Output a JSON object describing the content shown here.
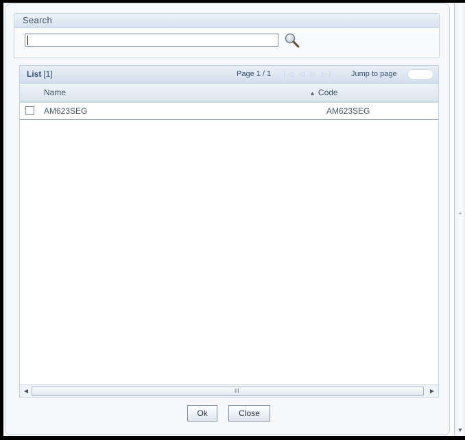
{
  "search": {
    "title": "Search",
    "input_value": "",
    "button_icon": "magnifier-icon"
  },
  "list": {
    "title": "List",
    "count": "[1]",
    "page_info": "Page 1 / 1",
    "jump_label": "Jump to page",
    "columns": {
      "name": "Name",
      "code": "Code"
    },
    "sort_indicator": "▲",
    "rows": [
      {
        "name": "AM623SEG",
        "code": "AM623SEG",
        "checked": false
      }
    ],
    "hscroll_grip": "III"
  },
  "buttons": {
    "ok": "Ok",
    "close": "Close"
  },
  "colors": {
    "panel_header": "#d8e4f0",
    "accent_text": "#34506e"
  }
}
